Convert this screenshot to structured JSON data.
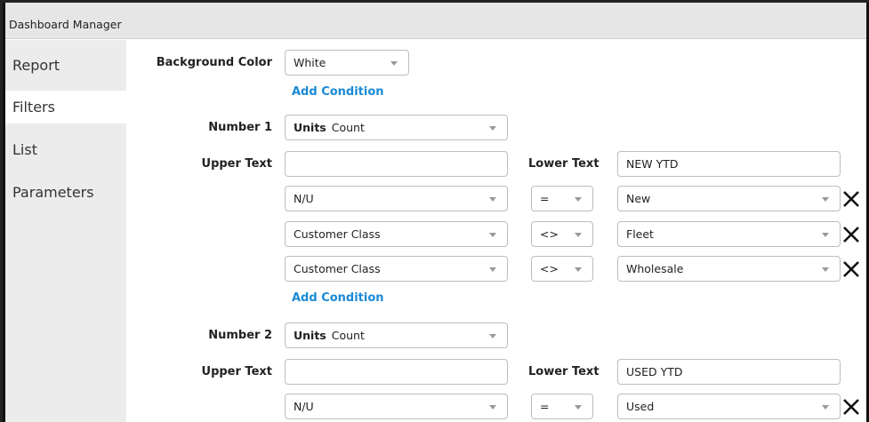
{
  "window": {
    "title": "Dashboard Manager"
  },
  "sidebar": {
    "items": [
      {
        "label": "Report"
      },
      {
        "label": "Filters"
      },
      {
        "label": "List"
      },
      {
        "label": "Parameters"
      }
    ]
  },
  "background": {
    "label": "Background Color",
    "value": "White"
  },
  "add_condition_label": "Add Condition",
  "numbers": [
    {
      "label": "Number 1",
      "units_label": "Units",
      "units_value": "Count",
      "upper_text_label": "Upper Text",
      "upper_text_value": "",
      "lower_text_label": "Lower Text",
      "lower_text_value": "NEW YTD",
      "conditions": [
        {
          "field": "N/U",
          "operator": "=",
          "value": "New"
        },
        {
          "field": "Customer Class",
          "operator": "<>",
          "value": "Fleet"
        },
        {
          "field": "Customer Class",
          "operator": "<>",
          "value": "Wholesale"
        }
      ]
    },
    {
      "label": "Number 2",
      "units_label": "Units",
      "units_value": "Count",
      "upper_text_label": "Upper Text",
      "upper_text_value": "",
      "lower_text_label": "Lower Text",
      "lower_text_value": "USED YTD",
      "conditions": [
        {
          "field": "N/U",
          "operator": "=",
          "value": "Used"
        }
      ]
    }
  ],
  "icons": {
    "remove": "close-icon",
    "dropdown": "chevron-down-icon"
  }
}
